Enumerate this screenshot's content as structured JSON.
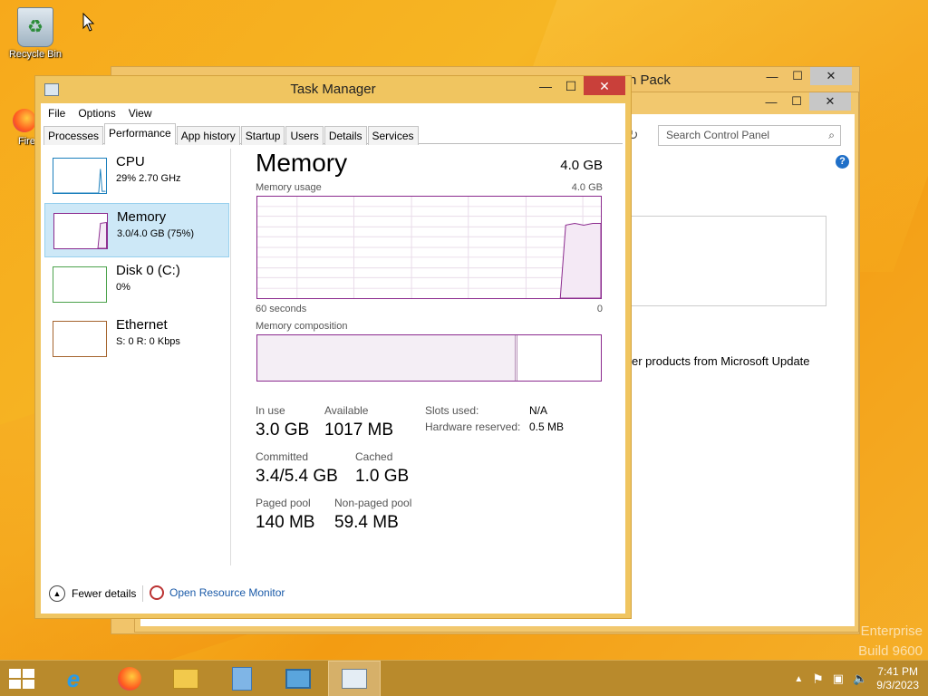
{
  "desktop": {
    "recycle_bin": "Recycle Bin",
    "firefox_label": "Fire",
    "watermark_line1": "Enterprise",
    "watermark_line2": "Build 9600"
  },
  "control_panel": {
    "title_fragment": "n Pack",
    "search_placeholder": "Search Control Panel",
    "help": "?",
    "text_fragment": "er products from Microsoft Update"
  },
  "task_manager": {
    "title": "Task Manager",
    "window_buttons": {
      "minimize": "—",
      "maximize": "☐",
      "close": "✕"
    },
    "menu": [
      "File",
      "Options",
      "View"
    ],
    "tabs": [
      "Processes",
      "Performance",
      "App history",
      "Startup",
      "Users",
      "Details",
      "Services"
    ],
    "active_tab": "Performance",
    "resources": [
      {
        "name": "CPU",
        "sub": "29% 2.70 GHz",
        "color": "#1b7fbc",
        "level": 0.29
      },
      {
        "name": "Memory",
        "sub": "3.0/4.0 GB (75%)",
        "color": "#8b2a8e",
        "level": 0.75,
        "selected": true
      },
      {
        "name": "Disk 0 (C:)",
        "sub": "0%",
        "color": "#4ca24c",
        "level": 0
      },
      {
        "name": "Ethernet",
        "sub": "S: 0 R: 0 Kbps",
        "color": "#a5642e",
        "level": 0
      }
    ],
    "detail": {
      "title": "Memory",
      "total": "4.0 GB",
      "usage_label": "Memory usage",
      "usage_max": "4.0 GB",
      "time_left": "60 seconds",
      "time_right": "0",
      "composition_label": "Memory composition",
      "in_use_fraction": 0.75,
      "stats": {
        "in_use_label": "In use",
        "in_use": "3.0 GB",
        "available_label": "Available",
        "available": "1017 MB",
        "committed_label": "Committed",
        "committed": "3.4/5.4 GB",
        "cached_label": "Cached",
        "cached": "1.0 GB",
        "paged_label": "Paged pool",
        "paged": "140 MB",
        "nonpaged_label": "Non-paged pool",
        "nonpaged": "59.4 MB",
        "slots_label": "Slots used:",
        "slots": "N/A",
        "hw_label": "Hardware reserved:",
        "hw": "0.5 MB"
      }
    },
    "footer": {
      "fewer": "Fewer details",
      "resmon": "Open Resource Monitor"
    }
  },
  "taskbar": {
    "apps": [
      "internet-explorer",
      "firefox",
      "file-explorer",
      "help",
      "control-panel",
      "task-manager"
    ],
    "time": "7:41 PM",
    "date": "9/3/2023"
  }
}
